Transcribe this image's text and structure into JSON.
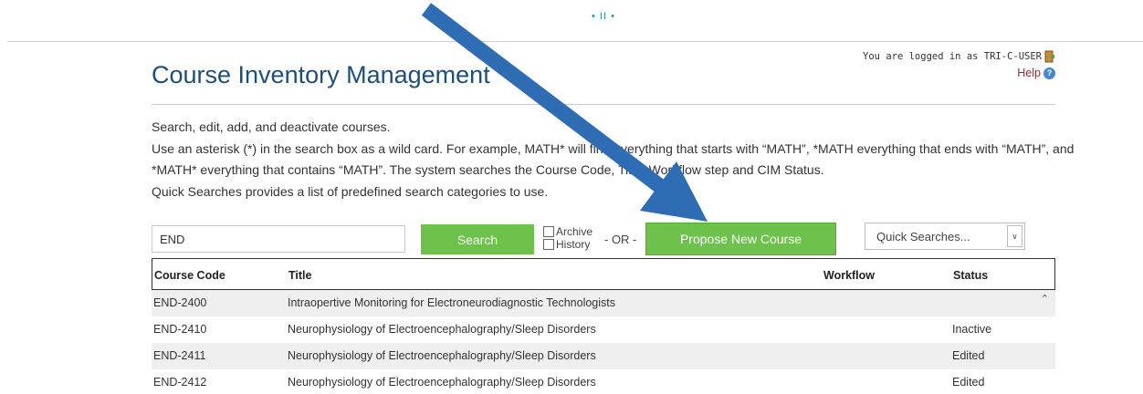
{
  "brand": {
    "logo_text": "• II •"
  },
  "header": {
    "title": "Course Inventory Management",
    "user_text": "You are logged in as TRI-C-USER",
    "help_label": "Help"
  },
  "intro": {
    "line1": "Search, edit, add, and deactivate courses.",
    "line2": "Use an asterisk (*) in the search box as a wild card. For example, MATH* will find everything that starts with “MATH”, *MATH everything that ends with “MATH”, and *MATH* everything that contains “MATH”. The system searches the Course Code, Title, Workflow step and CIM Status.",
    "line3": "Quick Searches provides a list of predefined search categories to use."
  },
  "search": {
    "value": "END",
    "button_label": "Search",
    "archive_label": "Archive",
    "history_label": "History",
    "or_label": "- OR -",
    "propose_label": "Propose New Course",
    "quick_searches": "Quick Searches..."
  },
  "table": {
    "headers": [
      "Course Code",
      "Title",
      "Workflow",
      "Status"
    ],
    "rows": [
      {
        "code": "END-2400",
        "title": "Intraopertive Monitoring for Electroneurodiagnostic Technologists",
        "workflow": "",
        "status": ""
      },
      {
        "code": "END-2410",
        "title": "Neurophysiology of Electroencephalography/Sleep Disorders",
        "workflow": "",
        "status": "Inactive"
      },
      {
        "code": "END-2411",
        "title": "Neurophysiology of Electroencephalography/Sleep Disorders",
        "workflow": "",
        "status": "Edited"
      },
      {
        "code": "END-2412",
        "title": "Neurophysiology of Electroencephalography/Sleep Disorders",
        "workflow": "",
        "status": "Edited"
      }
    ]
  },
  "colors": {
    "title": "#1f4e79",
    "button_green": "#6cc24a",
    "help_link": "#a3262f",
    "arrow_blue": "#2e6db4"
  },
  "icons": [
    "logout-icon",
    "help-icon",
    "chevron-down-icon",
    "scroll-up-icon",
    "annotation-arrow"
  ]
}
